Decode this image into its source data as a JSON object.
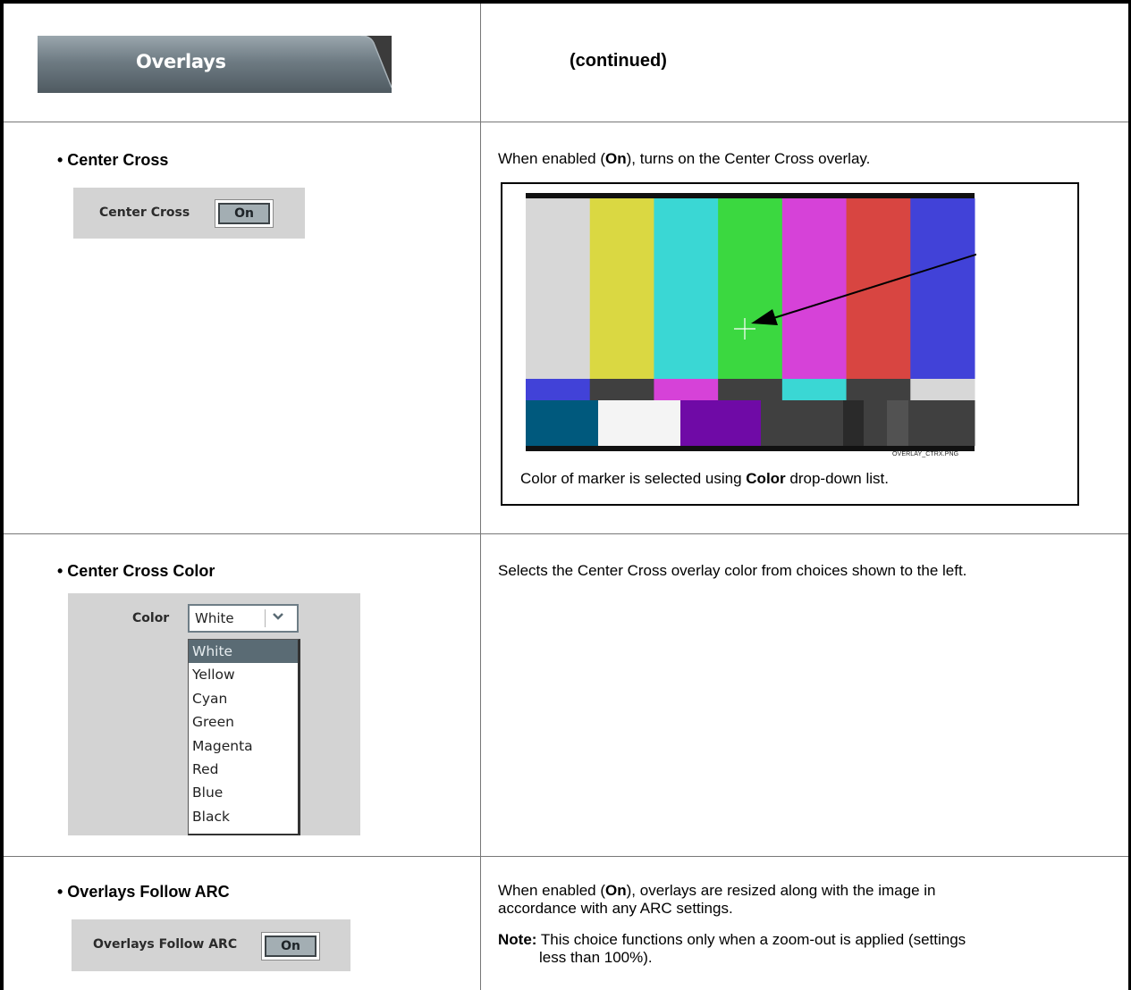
{
  "header": {
    "tab_label": "Overlays",
    "continued": "(continued)"
  },
  "rows": [
    {
      "heading": "• Center Cross",
      "control": {
        "label": "Center Cross",
        "value": "On"
      },
      "description_pre": "When enabled (",
      "description_bold": "On",
      "description_post": "), turns on the Center Cross overlay.",
      "figure": {
        "id": "OVERLAY_CTRX.PNG",
        "caption_pre": "Color of marker is selected using ",
        "caption_bold": "Color",
        "caption_post": " drop-down list.",
        "top_bar_colors": [
          "#d7d7d7",
          "#dad842",
          "#3ad7d4",
          "#3bd840",
          "#d642d8",
          "#d84541",
          "#4142d8"
        ],
        "mid_bar_colors": [
          "#4142d8",
          "#404040",
          "#d642d8",
          "#404040",
          "#3ad7d4",
          "#404040",
          "#d7d7d7"
        ],
        "bottom_bar_colors": [
          "#00597d",
          "#f4f4f4",
          "#6f0aa6",
          "#404040",
          "#2a2a2a",
          "#404040",
          "#525252",
          "#404040"
        ]
      }
    },
    {
      "heading": "• Center Cross Color",
      "dropdown": {
        "label": "Color",
        "value": "White",
        "options": [
          "White",
          "Yellow",
          "Cyan",
          "Green",
          "Magenta",
          "Red",
          "Blue",
          "Black"
        ],
        "selected": "White"
      },
      "description": "Selects the Center Cross overlay color from choices shown to the left."
    },
    {
      "heading": "• Overlays Follow ARC",
      "control": {
        "label": "Overlays Follow ARC",
        "value": "On"
      },
      "description_pre": "When enabled (",
      "description_bold": "On",
      "description_post": "), overlays are resized along with the image in",
      "description_line2": "accordance with any ARC settings.",
      "note_label": "Note:",
      "note_text": "This choice functions only when a zoom-out is applied (settings",
      "note_text2": "less than 100%)."
    }
  ]
}
